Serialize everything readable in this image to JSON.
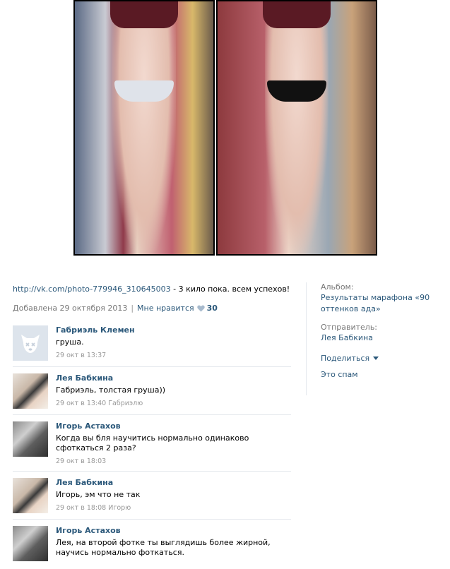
{
  "photo": {
    "link": "http://vk.com/photo-779946_310645003",
    "caption": "- 3 кило пока. всем успехов!",
    "added": "Добавлена 29 октября 2013",
    "like_label": "Мне нравится",
    "likes": "30"
  },
  "sidebar": {
    "album_label": "Альбом:",
    "album_value": "Результаты марафона «90 оттенков ада»",
    "sender_label": "Отправитель:",
    "sender_value": "Лея Бабкина",
    "share_label": "Поделиться",
    "spam_label": "Это спам"
  },
  "comments": [
    {
      "name": "Габриэль Клемен",
      "text": "груша.",
      "date": "29 окт в 13:37",
      "reply_to": "",
      "avatar": "dog-icon"
    },
    {
      "name": "Лея Бабкина",
      "text": "Габриэль, толстая груша))",
      "date": "29 окт в 13:40",
      "reply_to": "Габриэлю",
      "avatar": "photo"
    },
    {
      "name": "Игорь Астахов",
      "text": "Когда вы бля научитись нормально одинаково сфоткаться 2 раза?",
      "date": "29 окт в 18:03",
      "reply_to": "",
      "avatar": "photo"
    },
    {
      "name": "Лея Бабкина",
      "text": "Игорь, эм что не так",
      "date": "29 окт в 18:08",
      "reply_to": "Игорю",
      "avatar": "photo"
    },
    {
      "name": "Игорь Астахов",
      "text": "Лея, на второй фотке ты выглядишь более жирной, научись нормально фоткаться.",
      "date": "",
      "reply_to": "",
      "avatar": "photo"
    }
  ],
  "colors": {
    "link": "#2b587a",
    "meta": "#777777",
    "divider": "#e4e8ed"
  }
}
